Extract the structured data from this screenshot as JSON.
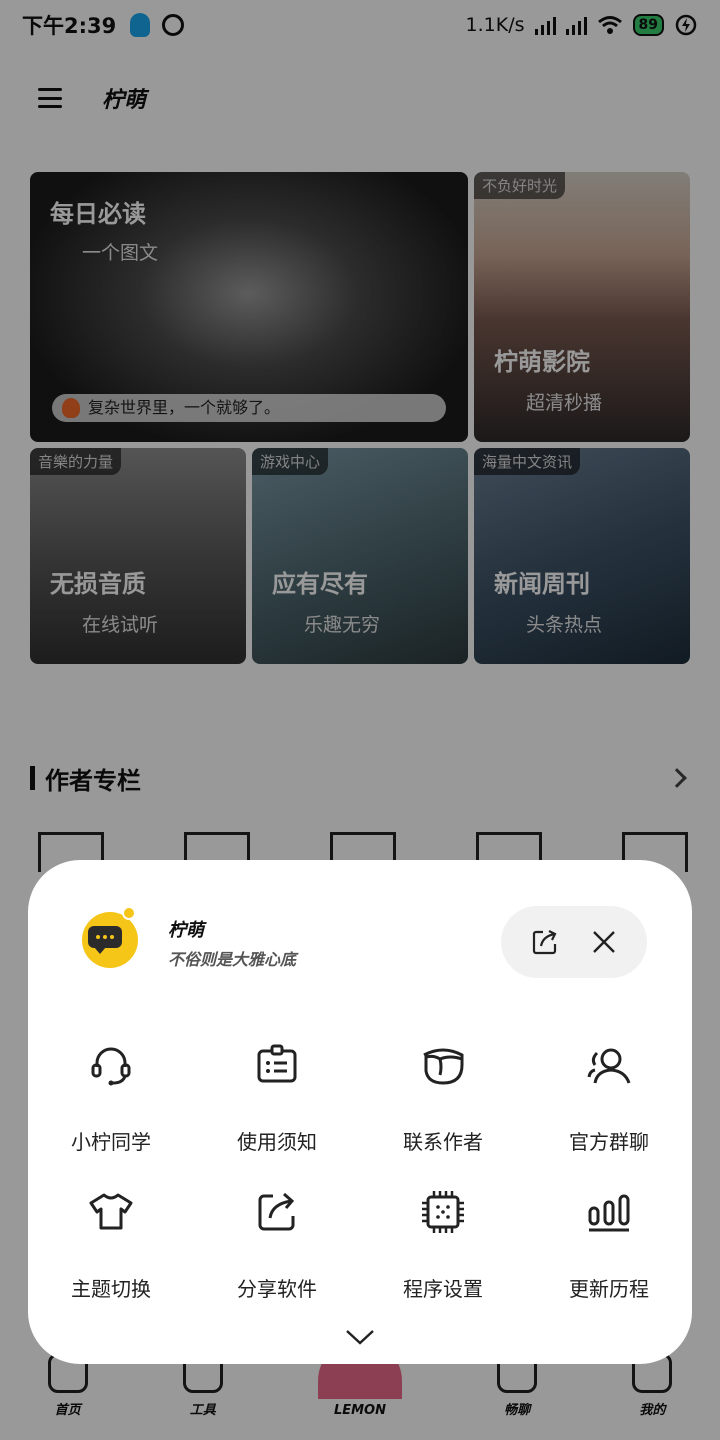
{
  "status_bar": {
    "time": "下午2:39",
    "net_speed": "1.1K/s",
    "battery": "89"
  },
  "app_bar": {
    "title": "柠萌"
  },
  "cards": {
    "daily": {
      "title": "每日必读",
      "subtitle": "一个图文",
      "quote": "复杂世界里，一个就够了。"
    },
    "cinema": {
      "tag": "不负好时光",
      "title": "柠萌影院",
      "subtitle": "超清秒播"
    },
    "music": {
      "tag": "音樂的力量",
      "title": "无损音质",
      "subtitle": "在线试听"
    },
    "games": {
      "tag": "游戏中心",
      "title": "应有尽有",
      "subtitle": "乐趣无穷"
    },
    "news": {
      "tag": "海量中文资讯",
      "title": "新闻周刊",
      "subtitle": "头条热点"
    }
  },
  "section": {
    "title": "作者专栏"
  },
  "bottom_nav": {
    "items": [
      {
        "label": "首页"
      },
      {
        "label": "工具"
      },
      {
        "label": "LEMON"
      },
      {
        "label": "畅聊"
      },
      {
        "label": "我的"
      }
    ]
  },
  "sheet": {
    "app_name": "柠萌",
    "slogan": "不俗则是大雅心底",
    "actions": [
      {
        "label": "小柠同学",
        "icon": "headset-icon"
      },
      {
        "label": "使用须知",
        "icon": "id-card-icon"
      },
      {
        "label": "联系作者",
        "icon": "face-mask-icon"
      },
      {
        "label": "官方群聊",
        "icon": "group-user-icon"
      },
      {
        "label": "主题切换",
        "icon": "tshirt-icon"
      },
      {
        "label": "分享软件",
        "icon": "share-icon"
      },
      {
        "label": "程序设置",
        "icon": "chip-icon"
      },
      {
        "label": "更新历程",
        "icon": "bar-history-icon"
      }
    ]
  },
  "colors": {
    "overlay": "#000000",
    "sheet_bg": "#ffffff",
    "pill_bg": "#f1f1f1",
    "logo_yellow": "#f5c518",
    "lemon_pink": "#e96a8a"
  }
}
